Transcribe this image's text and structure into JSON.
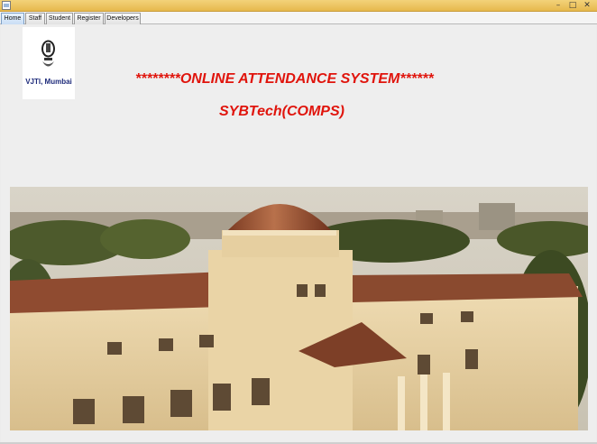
{
  "window": {
    "controls": {
      "minimize": "–",
      "maximize": "□",
      "close": "✕"
    }
  },
  "tabs": [
    {
      "label": "Home",
      "active": true
    },
    {
      "label": "Staff",
      "active": false
    },
    {
      "label": "Student",
      "active": false
    },
    {
      "label": "Register",
      "active": false
    },
    {
      "label": "Developers",
      "active": false
    }
  ],
  "logo": {
    "caption": "VJTI, Mumbai",
    "icon": "college-seal-icon"
  },
  "heading": "********ONLINE ATTENDANCE SYSTEM******",
  "subheading": "SYBTech(COMPS)",
  "photo": {
    "subject": "campus-building-photo"
  },
  "colors": {
    "heading": "#e0140c",
    "titlebar": "#e7b94d",
    "active_tab": "#c9def5"
  }
}
